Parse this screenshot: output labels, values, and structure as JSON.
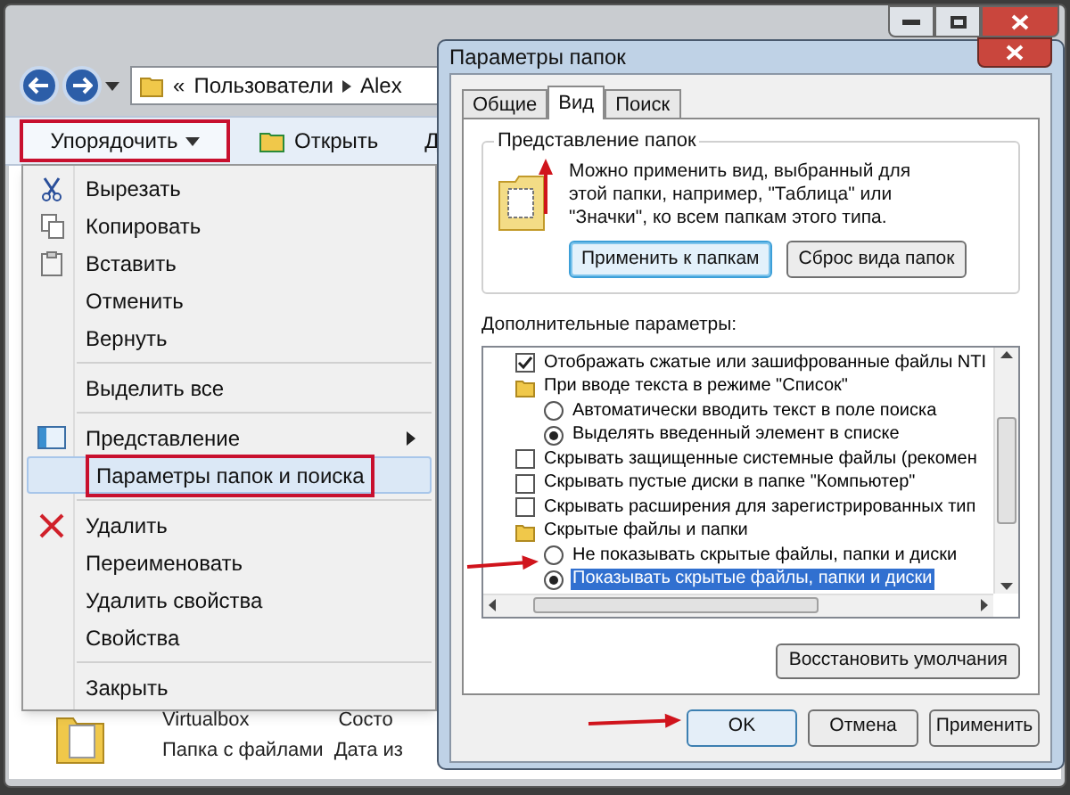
{
  "explorer": {
    "breadcrumb": {
      "prefix": "«",
      "segments": [
        "Пользователи",
        "Alex"
      ]
    },
    "toolbar": [
      {
        "label": "Упорядочить",
        "highlighted": true
      },
      {
        "label": "Открыть",
        "highlighted": false
      },
      {
        "label": "Д",
        "highlighted": false
      }
    ],
    "menu": {
      "groups": [
        [
          {
            "label": "Вырезать",
            "selected": false,
            "has_submenu": false
          },
          {
            "label": "Копировать",
            "selected": false,
            "has_submenu": false
          },
          {
            "label": "Вставить",
            "selected": false,
            "has_submenu": false
          },
          {
            "label": "Отменить",
            "selected": false,
            "has_submenu": false
          },
          {
            "label": "Вернуть",
            "selected": false,
            "has_submenu": false
          }
        ],
        [
          {
            "label": "Выделить все",
            "selected": false,
            "has_submenu": false
          }
        ],
        [
          {
            "label": "Представление",
            "selected": false,
            "has_submenu": true
          },
          {
            "label": "Параметры папок и поиска",
            "selected": true,
            "has_submenu": false
          }
        ],
        [
          {
            "label": "Удалить",
            "selected": false,
            "has_submenu": false
          },
          {
            "label": "Переименовать",
            "selected": false,
            "has_submenu": false
          },
          {
            "label": "Удалить свойства",
            "selected": false,
            "has_submenu": false
          },
          {
            "label": "Свойства",
            "selected": false,
            "has_submenu": false
          }
        ],
        [
          {
            "label": "Закрыть",
            "selected": false,
            "has_submenu": false
          }
        ]
      ]
    },
    "file": {
      "name": "Virtualbox",
      "type": "Папка с файлами",
      "date_label": "Дата из",
      "status": "Состо"
    }
  },
  "dialog": {
    "title": "Параметры папок",
    "tabs": [
      {
        "label": "Общие",
        "selected": false
      },
      {
        "label": "Вид",
        "selected": true
      },
      {
        "label": "Поиск",
        "selected": false
      }
    ],
    "group": {
      "title": "Представление папок",
      "text": "Можно применить вид, выбранный для этой папки, например, \"Таблица\" или \"Значки\", ко всем папкам этого типа.",
      "buttons": [
        {
          "label": "Применить к папкам",
          "focused": true
        },
        {
          "label": "Сброс вида папок",
          "focused": false
        }
      ]
    },
    "advanced_label": "Дополнительные параметры:",
    "settings": [
      {
        "kind": "checkbox",
        "label": "Отображать сжатые или зашифрованные файлы NTI",
        "checked": true,
        "selected": false
      },
      {
        "kind": "folder",
        "label": "При вводе текста в режиме \"Список\"",
        "selected": false,
        "children": [
          {
            "kind": "radio",
            "label": "Автоматически вводить текст в поле поиска",
            "checked": false,
            "selected": false
          },
          {
            "kind": "radio",
            "label": "Выделять введенный элемент в списке",
            "checked": true,
            "selected": false
          }
        ]
      },
      {
        "kind": "checkbox",
        "label": "Скрывать защищенные системные файлы (рекомен",
        "checked": false,
        "selected": false
      },
      {
        "kind": "checkbox",
        "label": "Скрывать пустые диски в папке \"Компьютер\"",
        "checked": false,
        "selected": false
      },
      {
        "kind": "checkbox",
        "label": "Скрывать расширения для зарегистрированных тип",
        "checked": false,
        "selected": false
      },
      {
        "kind": "folder",
        "label": "Скрытые файлы и папки",
        "selected": false,
        "children": [
          {
            "kind": "radio",
            "label": "Не показывать скрытые файлы, папки и диски",
            "checked": false,
            "selected": false
          },
          {
            "kind": "radio",
            "label": "Показывать скрытые файлы, папки и диски",
            "checked": true,
            "selected": true
          }
        ]
      }
    ],
    "restore_button": "Восстановить умолчания",
    "buttons": [
      {
        "label": "OK",
        "default": true
      },
      {
        "label": "Отмена",
        "default": false
      },
      {
        "label": "Применить",
        "default": false
      }
    ]
  }
}
